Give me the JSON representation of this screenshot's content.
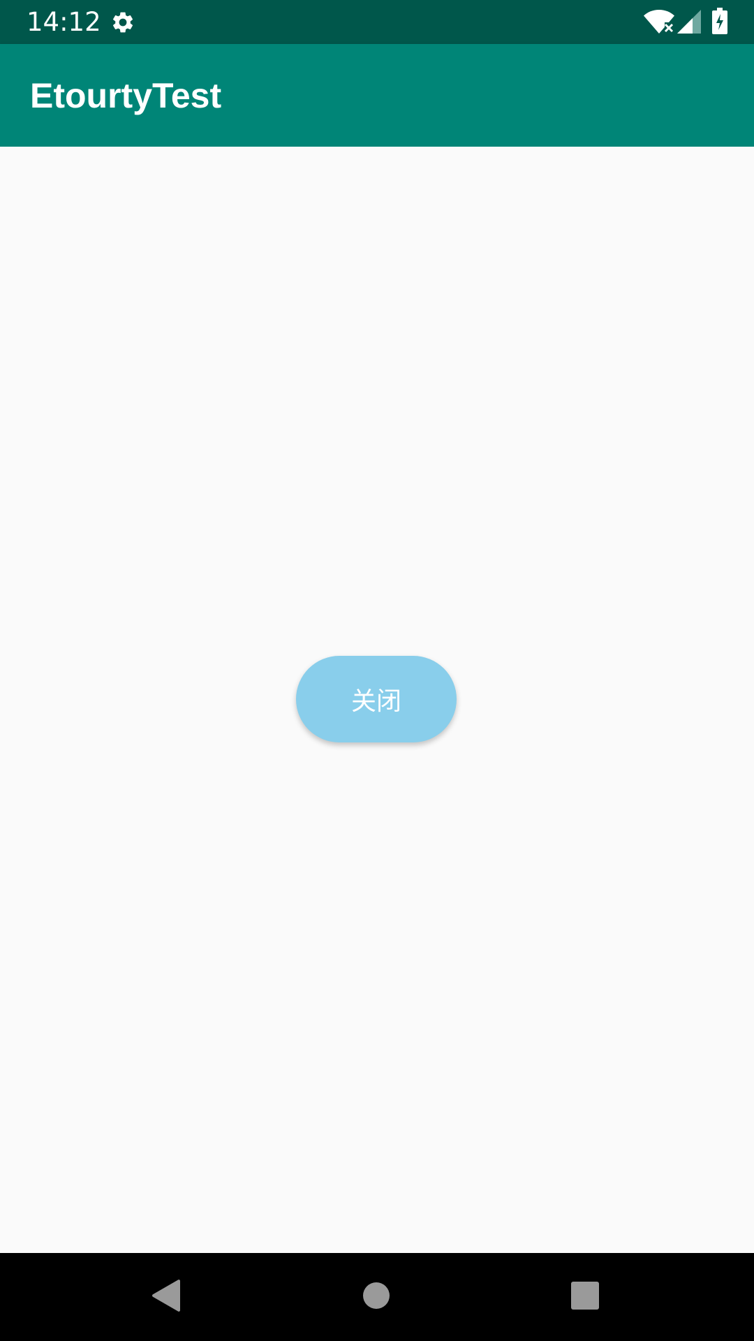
{
  "status_bar": {
    "time": "14:12",
    "icons": [
      "gear-icon",
      "wifi-off-icon",
      "cell-signal-icon",
      "battery-charging-icon"
    ],
    "background_color": "#00574b"
  },
  "app_bar": {
    "title": "EtourtyTest",
    "background_color": "#008577"
  },
  "main": {
    "close_button_label": "关闭",
    "button_color": "#89ceeb"
  },
  "nav_bar": {
    "buttons": [
      "back-icon",
      "home-icon",
      "recents-icon"
    ]
  }
}
